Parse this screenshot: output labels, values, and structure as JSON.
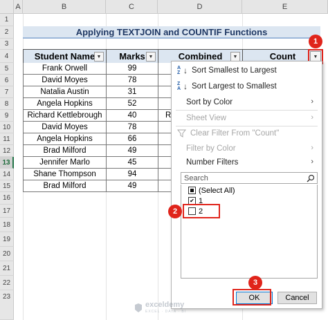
{
  "columns": [
    "A",
    "B",
    "C",
    "D",
    "E"
  ],
  "rows": [
    "1",
    "2",
    "3",
    "4",
    "5",
    "6",
    "7",
    "8",
    "9",
    "10",
    "11",
    "12",
    "13",
    "14",
    "15",
    "16",
    "17",
    "18",
    "19",
    "20",
    "21",
    "22",
    "23"
  ],
  "title": "Applying TEXTJOIN and COUNTIF Functions",
  "headers": {
    "student_name": "Student Name",
    "marks": "Marks",
    "combined": "Combined",
    "count": "Count"
  },
  "table_rows": [
    {
      "name": "Frank Orwell",
      "marks": "99"
    },
    {
      "name": "David Moyes",
      "marks": "78"
    },
    {
      "name": "Natalia Austin",
      "marks": "31"
    },
    {
      "name": "Angela Hopkins",
      "marks": "52"
    },
    {
      "name": "Richard Kettlebrough",
      "marks": "40"
    },
    {
      "name": "David Moyes",
      "marks": "78"
    },
    {
      "name": "Angela Hopkins",
      "marks": "66"
    },
    {
      "name": "Brad Milford",
      "marks": "49"
    },
    {
      "name": "Jennifer Marlo",
      "marks": "45"
    },
    {
      "name": "Shane Thompson",
      "marks": "94"
    },
    {
      "name": "Brad Milford",
      "marks": "49"
    }
  ],
  "combined_partial": "R",
  "menu": {
    "sort_asc": "Sort Smallest to Largest",
    "sort_desc": "Sort Largest to Smallest",
    "sort_color": "Sort by Color",
    "sheet_view": "Sheet View",
    "clear_filter": "Clear Filter From \"Count\"",
    "filter_color": "Filter by Color",
    "number_filters": "Number Filters",
    "search_placeholder": "Search",
    "select_all": "(Select All)",
    "option_1": "1",
    "option_2": "2",
    "ok": "OK",
    "cancel": "Cancel",
    "az_top": "A",
    "az_bottom": "Z",
    "za_top": "Z",
    "za_bottom": "A"
  },
  "badges": {
    "b1": "1",
    "b2": "2",
    "b3": "3"
  },
  "watermark": {
    "brand": "exceldemy",
    "tagline": "EXCEL · DATA · BI"
  },
  "colors": {
    "accent_red": "#e0241b",
    "header_fill": "#dce6f1",
    "title_text": "#1f3864"
  }
}
